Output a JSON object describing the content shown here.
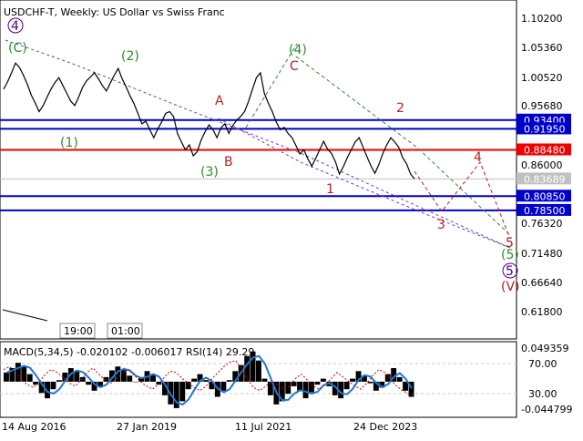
{
  "header": {
    "symbol": "USDCHF-T",
    "timeframe": "Weekly",
    "description": "US Dollar vs Swiss Franc"
  },
  "colors": {
    "background": "#ffffff",
    "price_line": "#000000",
    "support_resistance": "#0000cc",
    "key_level": "#ee0000",
    "level_label_bg": "#0000cc",
    "key_label_bg": "#ee0000",
    "current_price_bg": "#c0c0c0",
    "wave_green": "#2e8b2e",
    "wave_red": "#b22222",
    "wave_purple": "#4b0082",
    "channel_purple": "#6a3db8",
    "macd_hist": "#000000",
    "macd_signal": "#1e78d7",
    "rsi": "#cc0000",
    "grid": "#c8c8c8"
  },
  "chart_data": [
    {
      "type": "line",
      "title": "USDCHF-T, Weekly:  US Dollar vs Swiss Franc",
      "y_axis_ticks": [
        "1.10200",
        "1.05360",
        "1.00520",
        "0.95680",
        "0.86000",
        "0.76320",
        "0.71480",
        "0.66640",
        "0.61800"
      ],
      "ylim": [
        0.5955,
        1.121
      ],
      "price_levels": [
        {
          "label": "0.93400",
          "value": 0.934,
          "color": "blue"
        },
        {
          "label": "0.91950",
          "value": 0.9195,
          "color": "blue"
        },
        {
          "label": "0.88480",
          "value": 0.8848,
          "color": "red"
        },
        {
          "label": "0.80850",
          "value": 0.8085,
          "color": "blue"
        },
        {
          "label": "0.78500",
          "value": 0.785,
          "color": "blue"
        }
      ],
      "current_price": {
        "label": "0.83689",
        "value": 0.83689
      },
      "series": [
        {
          "values": [
            0.985,
            0.997,
            1.012,
            1.028,
            1.021,
            1.008,
            0.993,
            0.975,
            0.962,
            0.948,
            0.958,
            0.972,
            0.985,
            0.996,
            1.004,
            0.991,
            0.978,
            0.965,
            0.958,
            0.972,
            0.988,
            0.999,
            1.005,
            1.012,
            1.002,
            0.991,
            0.982,
            0.995,
            1.008,
            1.019,
            1.002,
            0.989,
            0.974,
            0.961,
            0.945,
            0.928,
            0.932,
            0.918,
            0.905,
            0.919,
            0.931,
            0.945,
            0.948,
            0.94,
            0.912,
            0.898,
            0.885,
            0.893,
            0.875,
            0.882,
            0.901,
            0.915,
            0.926,
            0.918,
            0.905,
            0.921,
            0.928,
            0.912,
            0.925,
            0.934,
            0.94,
            0.948,
            0.965,
            0.985,
            1.004,
            1.012,
            0.978,
            0.962,
            0.948,
            0.931,
            0.918,
            0.922,
            0.912,
            0.905,
            0.892,
            0.878,
            0.885,
            0.87,
            0.858,
            0.871,
            0.885,
            0.899,
            0.886,
            0.879,
            0.865,
            0.845,
            0.857,
            0.872,
            0.885,
            0.898,
            0.905,
            0.889,
            0.873,
            0.858,
            0.846,
            0.861,
            0.879,
            0.893,
            0.905,
            0.898,
            0.889,
            0.872,
            0.862,
            0.845,
            0.837
          ]
        }
      ]
    },
    {
      "type": "line",
      "title": "MACD(5,34,5) -0.020102 -0.006017 RSI(14) 29.29",
      "y_axis_ticks": [
        "0.049359",
        "70.00",
        "30.00",
        "-0.044799"
      ],
      "series": [
        {
          "name": "MACD(5,34,5)",
          "values": [
            0.012,
            0.018,
            0.025,
            0.02,
            0.01,
            -0.004,
            -0.015,
            -0.022,
            -0.01,
            0.002,
            0.012,
            0.018,
            0.014,
            0.006,
            -0.004,
            -0.012,
            -0.006,
            0.006,
            0.015,
            0.02,
            0.016,
            0.008,
            0.0,
            0.006,
            0.014,
            0.01,
            -0.004,
            -0.018,
            -0.03,
            -0.035,
            -0.026,
            -0.01,
            0.004,
            0.01,
            0.002,
            -0.01,
            -0.02,
            -0.012,
            0.002,
            0.014,
            0.022,
            0.034,
            0.04,
            0.028,
            0.004,
            -0.018,
            -0.03,
            -0.026,
            -0.016,
            -0.006,
            -0.012,
            -0.022,
            -0.014,
            -0.004,
            0.004,
            -0.006,
            -0.018,
            -0.022,
            -0.01,
            0.004,
            0.014,
            0.008,
            -0.002,
            -0.012,
            -0.008,
            0.01,
            0.018,
            0.006,
            -0.012,
            -0.02
          ]
        },
        {
          "name": "RSI(14)",
          "values": [
            62,
            66,
            58,
            48,
            42,
            38,
            46,
            56,
            62,
            58,
            52,
            44,
            40,
            48,
            58,
            64,
            56,
            48,
            44,
            50,
            58,
            62,
            54,
            46,
            40,
            36,
            42,
            52,
            60,
            58,
            50,
            44,
            38,
            34,
            40,
            50,
            58,
            66,
            72,
            74,
            62,
            48,
            38,
            34,
            40,
            46,
            42,
            36,
            40,
            50,
            56,
            48,
            40,
            36,
            42,
            50,
            58,
            52,
            46,
            40,
            36,
            44,
            54,
            62,
            58,
            48,
            40,
            34,
            30,
            29.29
          ]
        }
      ]
    }
  ],
  "wave_labels": {
    "w4_top": "4",
    "wC_top": "(C)",
    "w2_green": "(2)",
    "w4_green": "(4)",
    "wC_red": "C",
    "wA_red": "A",
    "w2_red": "2",
    "w1_green": "(1)",
    "w3_green": "(3)",
    "wB_red": "B",
    "w4_red": "4",
    "w1_red": "1",
    "w3_red": "3",
    "w5_red": "5",
    "w5_green": "(5)",
    "w5_circle": "5",
    "wV_red": "(V)"
  },
  "mini_panel": {
    "time_a": "19:00",
    "time_b": "01:00"
  },
  "x_axis": [
    "14 Aug 2016",
    "27 Jan 2019",
    "11 Jul 2021",
    "24 Dec 2023"
  ]
}
